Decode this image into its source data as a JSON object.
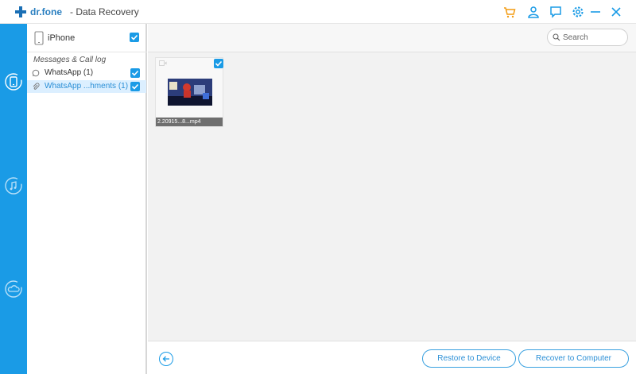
{
  "window": {
    "brand": "dr.fone",
    "title": "- Data Recovery"
  },
  "colors": {
    "accent": "#1a9be6",
    "cart": "#f39c12",
    "selected_bg": "#dcefff"
  },
  "titlebar_icons": [
    "cart-icon",
    "user-icon",
    "feedback-icon",
    "settings-icon",
    "minimize-icon",
    "close-icon"
  ],
  "nav_icons": [
    "device-recovery-icon",
    "itunes-recovery-icon",
    "icloud-recovery-icon"
  ],
  "tree": {
    "device": "iPhone",
    "section": "Messages & Call log",
    "items": [
      {
        "label": "WhatsApp (1)",
        "icon": "whatsapp-icon",
        "checked": true,
        "selected": false
      },
      {
        "label": "WhatsApp ...hments (1)",
        "icon": "attachment-icon",
        "checked": true,
        "selected": true
      }
    ]
  },
  "search": {
    "placeholder": "Search"
  },
  "files": [
    {
      "name": "2.20915...8...mp4",
      "checked": true
    }
  ],
  "footer": {
    "restore_label": "Restore to Device",
    "recover_label": "Recover to Computer"
  }
}
